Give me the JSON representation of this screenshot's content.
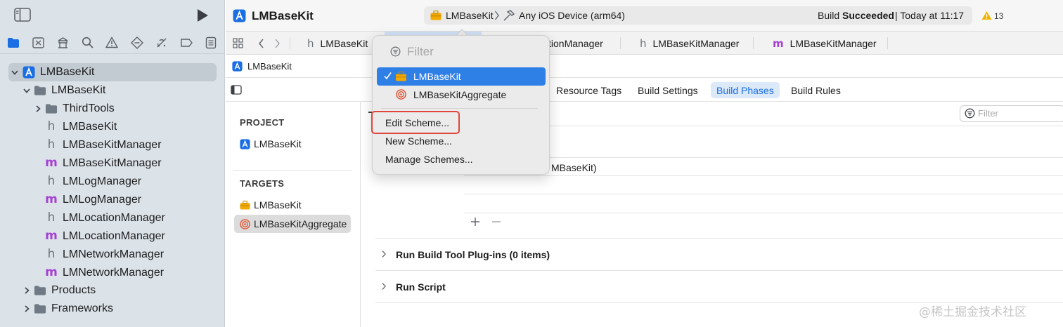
{
  "sidebar": {
    "items": [
      {
        "label": "LMBaseKit",
        "kind": "project",
        "expanded": true
      },
      {
        "label": "LMBaseKit",
        "kind": "folder",
        "expanded": true
      },
      {
        "label": "ThirdTools",
        "kind": "folder",
        "expanded": false
      },
      {
        "label": "LMBaseKit",
        "kind": "header-file",
        "glyph": "h"
      },
      {
        "label": "LMBaseKitManager",
        "kind": "header-file",
        "glyph": "h"
      },
      {
        "label": "LMBaseKitManager",
        "kind": "implementation-file",
        "glyph": "m"
      },
      {
        "label": "LMLogManager",
        "kind": "header-file",
        "glyph": "h"
      },
      {
        "label": "LMLogManager",
        "kind": "implementation-file",
        "glyph": "m"
      },
      {
        "label": "LMLocationManager",
        "kind": "header-file",
        "glyph": "h"
      },
      {
        "label": "LMLocationManager",
        "kind": "implementation-file",
        "glyph": "m"
      },
      {
        "label": "LMNetworkManager",
        "kind": "header-file",
        "glyph": "h"
      },
      {
        "label": "LMNetworkManager",
        "kind": "implementation-file",
        "glyph": "m"
      },
      {
        "label": "Products",
        "kind": "folder",
        "expanded": false
      },
      {
        "label": "Frameworks",
        "kind": "folder",
        "expanded": false
      }
    ]
  },
  "toolbar": {
    "project_title": "LMBaseKit",
    "scheme": "LMBaseKit",
    "destination": "Any iOS Device (arm64)",
    "status_prefix": "Build ",
    "status_strong": "Succeeded",
    "status_time": "| Today at 11:17",
    "warning_count": "13"
  },
  "tabs": [
    {
      "glyph": "h",
      "label": "LMBaseKit"
    },
    {
      "glyph": "",
      "label": "tionManager"
    },
    {
      "glyph": "h",
      "label": "LMBaseKitManager"
    },
    {
      "glyph": "m",
      "label": "LMBaseKitManager"
    }
  ],
  "jumpbar": {
    "label": "LMBaseKit"
  },
  "phase_tabs": [
    "Resource Tags",
    "Build Settings",
    "Build Phases",
    "Build Rules"
  ],
  "active_phase_tab": "Build Phases",
  "filter_placeholder": "Filter",
  "targets": {
    "project_header": "PROJECT",
    "project_item": "LMBaseKit",
    "targets_header": "TARGETS",
    "target_items": [
      "LMBaseKit",
      "LMBaseKitAggregate"
    ],
    "selected_target": "LMBaseKitAggregate"
  },
  "content": {
    "partial_row": "MBaseKit)",
    "phases": [
      "Run Build Tool Plug-ins (0 items)",
      "Run Script"
    ]
  },
  "popup": {
    "filter_placeholder": "Filter",
    "schemes": [
      "LMBaseKit",
      "LMBaseKitAggregate"
    ],
    "selected_scheme": "LMBaseKit",
    "actions": [
      "Edit Scheme...",
      "New Scheme...",
      "Manage Schemes..."
    ],
    "highlighted_action": "Edit Scheme..."
  },
  "watermark": "@稀土掘金技术社区",
  "colors": {
    "accent": "#1a6ee4",
    "sidebar_bg": "#dce3e8",
    "highlight_border": "#e2453a",
    "implementation_glyph": "#a53fd6",
    "warning": "#f0b400"
  }
}
